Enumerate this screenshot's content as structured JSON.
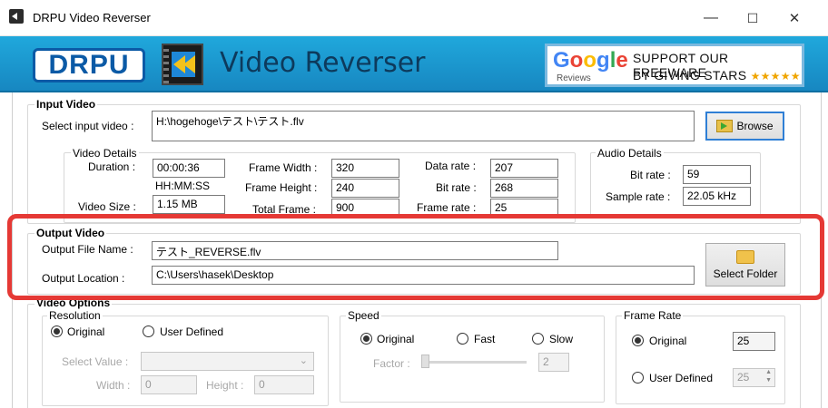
{
  "window": {
    "title": "DRPU Video Reverser",
    "minimize": "—",
    "maximize": "☐",
    "close": "✕"
  },
  "banner": {
    "logo": "DRPU",
    "title": "Video Reverser",
    "google": "Google",
    "reviews": "Reviews",
    "support1": "SUPPORT OUR FREEWARE",
    "support2": "BY GIVING STARS",
    "stars": "★★★★★",
    "colors": {
      "banner": "#1f9fd6",
      "logo_blue": "#0b5aa6",
      "highlight": "#e53935"
    }
  },
  "input_video": {
    "legend": "Input Video",
    "select_label": "Select input video :",
    "path": "H:\\hogehoge\\テスト\\テスト.flv",
    "browse": "Browse"
  },
  "video_details": {
    "legend": "Video Details",
    "duration_label": "Duration :",
    "duration": "00:00:36",
    "duration_hint": "HH:MM:SS",
    "video_size_label": "Video Size :",
    "video_size": "1.15 MB",
    "frame_width_label": "Frame Width :",
    "frame_width": "320",
    "frame_height_label": "Frame Height :",
    "frame_height": "240",
    "total_frame_label": "Total Frame :",
    "total_frame": "900",
    "data_rate_label": "Data rate :",
    "data_rate": "207",
    "bit_rate_label": "Bit rate :",
    "bit_rate": "268",
    "frame_rate_label": "Frame rate :",
    "frame_rate": "25"
  },
  "audio_details": {
    "legend": "Audio Details",
    "bit_rate_label": "Bit rate :",
    "bit_rate": "59",
    "sample_rate_label": "Sample rate :",
    "sample_rate": "22.05 kHz"
  },
  "output_video": {
    "legend": "Output Video",
    "file_name_label": "Output File Name :",
    "file_name": "テスト_REVERSE.flv",
    "location_label": "Output Location :",
    "location": "C:\\Users\\hasek\\Desktop",
    "select_folder": "Select Folder"
  },
  "video_options": {
    "legend": "Video Options",
    "resolution": {
      "legend": "Resolution",
      "original": "Original",
      "user_defined": "User Defined",
      "selected": "original",
      "select_value_label": "Select Value :",
      "width_label": "Width :",
      "width": "0",
      "height_label": "Height :",
      "height": "0"
    },
    "speed": {
      "legend": "Speed",
      "original": "Original",
      "fast": "Fast",
      "slow": "Slow",
      "selected": "original",
      "factor_label": "Factor :",
      "factor": "2"
    },
    "frame_rate": {
      "legend": "Frame Rate",
      "original": "Original",
      "user_defined": "User Defined",
      "selected": "original",
      "original_value": "25",
      "user_value": "25"
    }
  }
}
